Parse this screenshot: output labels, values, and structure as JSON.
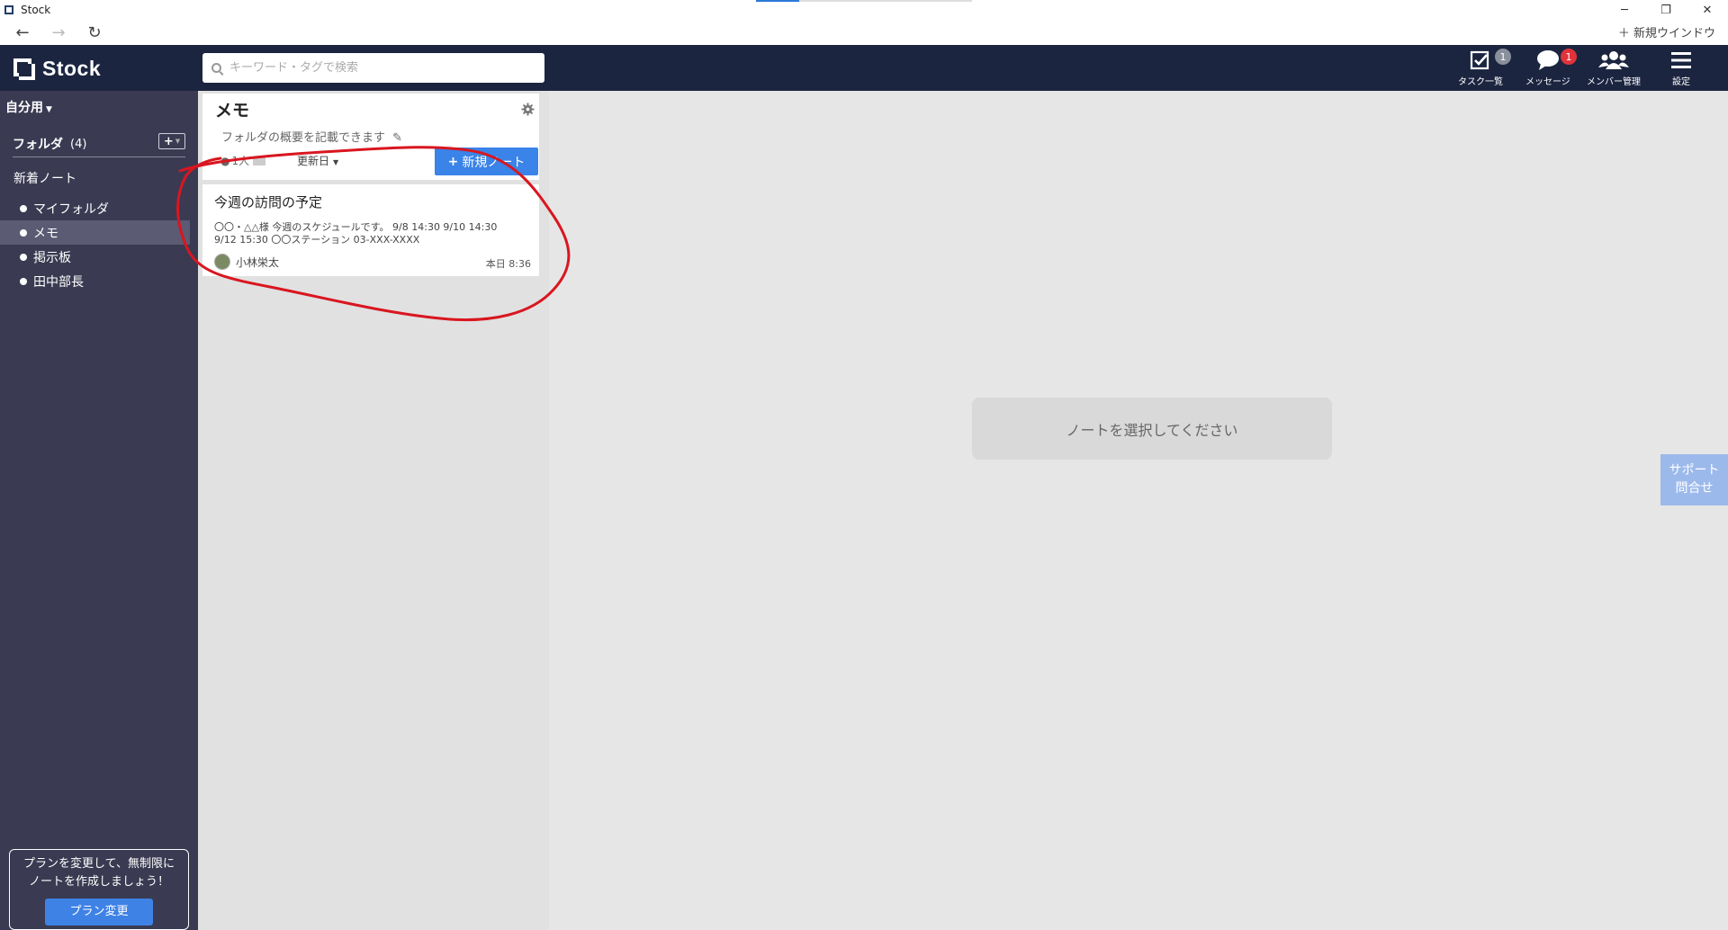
{
  "window": {
    "title": "Stock",
    "controls": {
      "minimize": "─",
      "restore": "❐",
      "close": "✕"
    }
  },
  "nav": {
    "back": "←",
    "forward": "→",
    "reload": "↻",
    "new_window": "＋ 新規ウインドウ"
  },
  "header": {
    "logo": "Stock",
    "search_placeholder": "キーワード・タグで検索",
    "items": [
      {
        "label": "タスク一覧",
        "badge": "1",
        "icon": "checkbox-icon"
      },
      {
        "label": "メッセージ",
        "badge": "1",
        "icon": "chat-bubble-icon"
      },
      {
        "label": "メンバー管理",
        "icon": "members-icon"
      },
      {
        "label": "設定",
        "icon": "hamburger-icon"
      }
    ]
  },
  "sidebar": {
    "workspace": "自分用",
    "folder_label": "フォルダ",
    "folder_count": "(4)",
    "add_button": "+",
    "new_notes": "新着ノート",
    "folders": [
      {
        "label": "マイフォルダ",
        "active": false
      },
      {
        "label": "メモ",
        "active": true
      },
      {
        "label": "掲示板",
        "active": false
      },
      {
        "label": "田中部長",
        "active": false
      }
    ],
    "plan": {
      "line1": "プランを変更して、無制限に",
      "line2": "ノートを作成しましょう！",
      "button": "プラン変更"
    }
  },
  "folder": {
    "title": "メモ",
    "description": "フォルダの概要を記載できます",
    "members": "1人",
    "sort": "更新日",
    "new_note": "新規ノート"
  },
  "notes": [
    {
      "title": "今週の訪問の予定",
      "body_line1": "〇〇・△△様 今週のスケジュールです。 9/8 14:30 9/10 14:30",
      "body_line2": "9/12 15:30 〇〇ステーション 03-XXX-XXXX",
      "author": "小林栄太",
      "time": "本日 8:36"
    }
  ],
  "main": {
    "empty_message": "ノートを選択してください",
    "support_line1": "サポート",
    "support_line2": "問合せ"
  },
  "colors": {
    "header_bg": "#1b2540",
    "sidebar_bg": "#3a3a52",
    "accent_blue": "#3a83e8",
    "annotation_red": "#d9161f"
  }
}
